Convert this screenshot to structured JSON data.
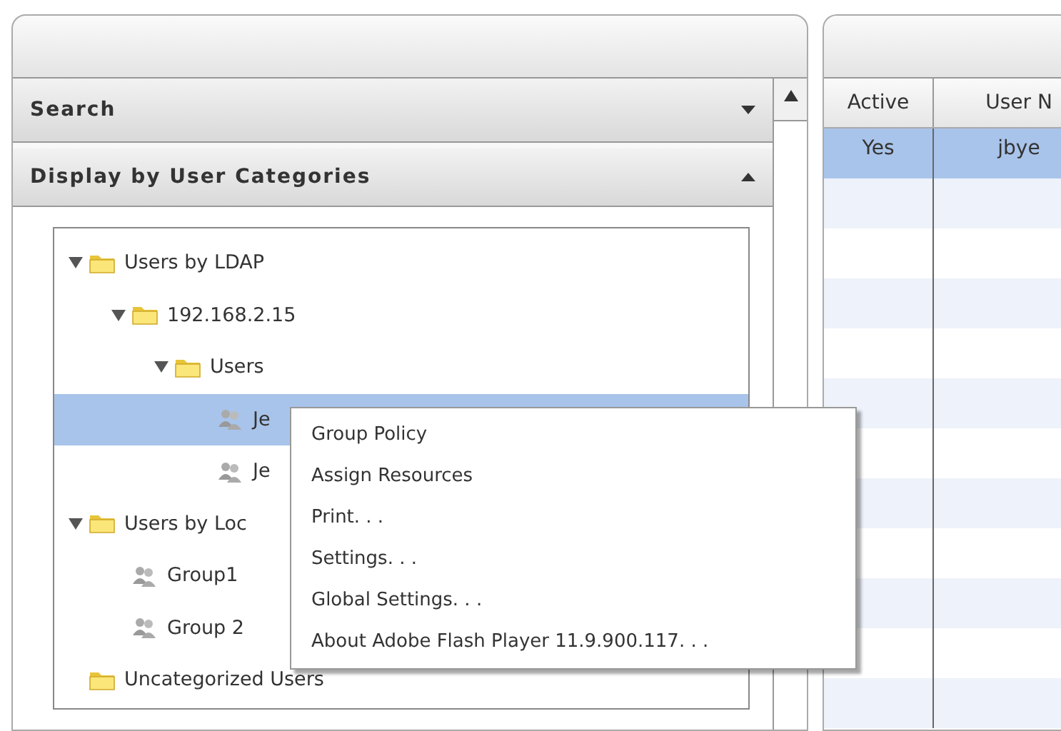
{
  "left_panel": {
    "sections": [
      {
        "title": "Search",
        "expanded": false
      },
      {
        "title": "Display by User Categories",
        "expanded": true
      }
    ],
    "tree": [
      {
        "label": "Users by LDAP",
        "kind": "folder",
        "expanded": true,
        "selected": false,
        "children": [
          {
            "label": "192.168.2.15",
            "kind": "folder",
            "expanded": true,
            "selected": false,
            "children": [
              {
                "label": "Users",
                "kind": "folder",
                "expanded": true,
                "selected": false,
                "children": [
                  {
                    "label": "Je",
                    "kind": "group",
                    "selected": true
                  },
                  {
                    "label": "Je",
                    "kind": "group",
                    "selected": false
                  }
                ]
              }
            ]
          }
        ]
      },
      {
        "label": "Users by Loc",
        "kind": "folder",
        "expanded": true,
        "selected": false,
        "children": [
          {
            "label": "Group1",
            "kind": "group",
            "selected": false
          },
          {
            "label": "Group 2",
            "kind": "group",
            "selected": false
          }
        ]
      },
      {
        "label": "Uncategorized Users",
        "kind": "folder",
        "selected": false
      }
    ]
  },
  "table": {
    "columns": [
      "Active",
      "User N"
    ],
    "rows": [
      {
        "cells": [
          "Yes",
          "jbye"
        ],
        "selected": true
      }
    ]
  },
  "context_menu": [
    "Group Policy",
    "Assign Resources",
    "Print. . .",
    "Settings. . .",
    "Global Settings. . .",
    "About Adobe Flash Player 11.9.900.117. . ."
  ]
}
